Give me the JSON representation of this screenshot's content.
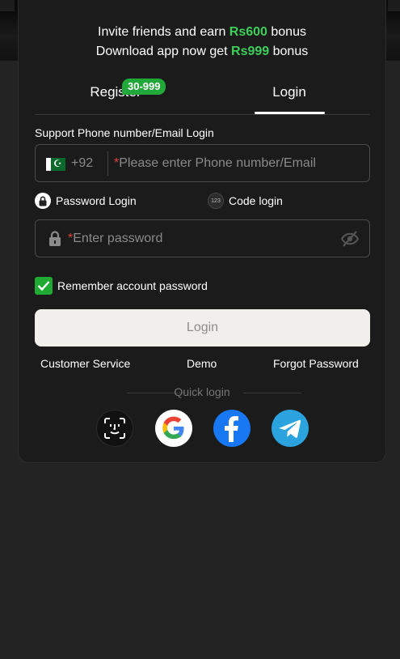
{
  "promo": {
    "line1_prefix": "Invite friends and earn ",
    "line1_amount": "Rs600",
    "line1_suffix": " bonus",
    "line2_prefix": "Download app now get ",
    "line2_amount": "Rs999",
    "line2_suffix": " bonus"
  },
  "tabs": {
    "register_label": "Register",
    "register_badge": "30-999",
    "login_label": "Login",
    "active": "login"
  },
  "form": {
    "support_label": "Support Phone number/Email Login",
    "country_code": "+92",
    "phone_placeholder": "Please enter Phone number/Email",
    "required_mark": "*",
    "mode_password_label": "Password Login",
    "mode_code_label": "Code login",
    "mode_code_icon_text": "123",
    "password_placeholder": "Enter password",
    "remember_label": "Remember account password",
    "remember_checked": true,
    "login_button_label": "Login"
  },
  "links": {
    "customer_service": "Customer Service",
    "demo": "Demo",
    "forgot_password": "Forgot Password"
  },
  "quick_login": {
    "label": "Quick login",
    "providers": [
      "face-id-icon",
      "google-icon",
      "facebook-icon",
      "telegram-icon"
    ]
  },
  "colors": {
    "accent_green": "#3ccf5a",
    "badge_green": "#22a83a",
    "required_red": "#e0443e",
    "facebook_blue": "#1877f2",
    "telegram_blue": "#2aa3de"
  }
}
